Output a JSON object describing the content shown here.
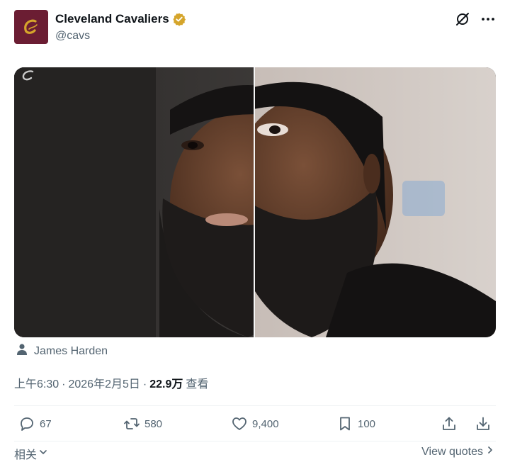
{
  "post": {
    "display_name": "Cleveland Cavaliers",
    "handle": "@cavs",
    "tagged_user": "James Harden",
    "time": "上午6:30",
    "sep1": "·",
    "date": "2026年2月5日",
    "sep2": "·",
    "views_count": "22.9万",
    "views_label": "查看"
  },
  "actions": {
    "replies": "67",
    "reposts": "580",
    "likes": "9,400",
    "bookmarks": "100"
  },
  "footer": {
    "related_label": "相关",
    "view_quotes_label": "View quotes"
  },
  "icons": {
    "verified": "verified-badge-icon",
    "grok": "grok-icon",
    "more": "more-icon",
    "tag": "person-icon",
    "reply": "reply-icon",
    "repost": "repost-icon",
    "like": "heart-icon",
    "bookmark": "bookmark-icon",
    "share": "share-icon",
    "download": "download-icon"
  },
  "colors": {
    "brand": "#6b1d33",
    "gold": "#d5a52b",
    "text_secondary": "#536471"
  }
}
